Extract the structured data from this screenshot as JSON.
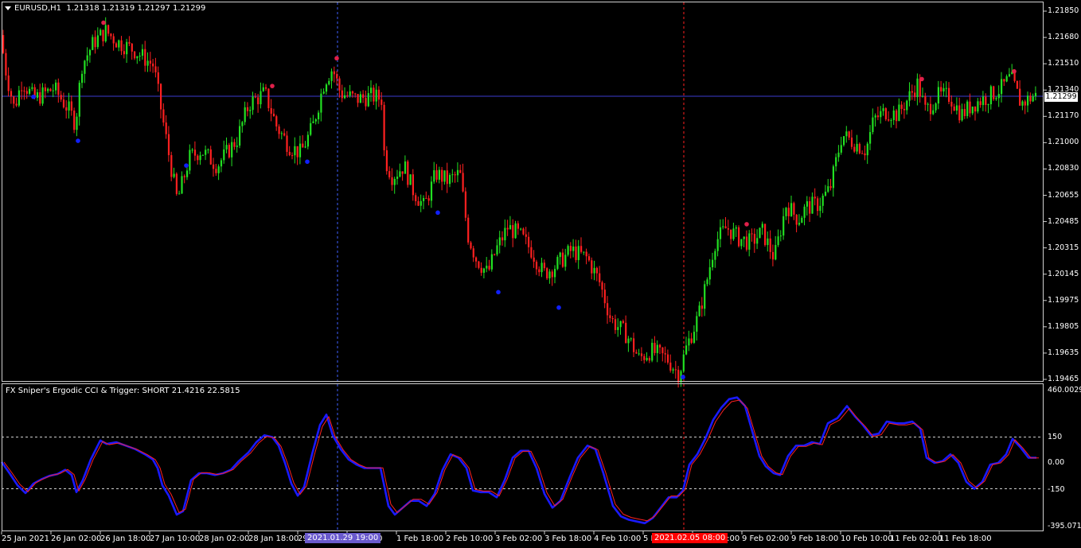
{
  "symbol": "EURUSD,H1",
  "ohlc": {
    "open": "1.21318",
    "high": "1.21319",
    "low": "1.21297",
    "close": "1.21299"
  },
  "indicator": {
    "name": "FX Sniper's Ergodic CCI & Trigger:",
    "signal": "SHORT",
    "value1": "21.4216",
    "value2": "22.5815"
  },
  "price_axis": [
    "1.21850",
    "1.21680",
    "1.21510",
    "1.21340",
    "1.21170",
    "1.21000",
    "1.20830",
    "1.20655",
    "1.20485",
    "1.20315",
    "1.20145",
    "1.19975",
    "1.19805",
    "1.19635",
    "1.19465"
  ],
  "current_price": "1.21299",
  "indicator_axis": {
    "max": "460.0029",
    "upper": "150",
    "zero": "0.00",
    "lower": "-150",
    "min": "-395.0718"
  },
  "time_axis": [
    "25 Jan 2021",
    "26 Jan 02:00",
    "26 Jan 18:00",
    "27 Jan 10:00",
    "28 Jan 02:00",
    "28 Jan 18:00",
    "29 Jan 10:00",
    "eb 02:00",
    "1 Feb 18:00",
    "2 Feb 10:00",
    "3 Feb 02:00",
    "3 Feb 18:00",
    "4 Feb 10:00",
    "5 Feb 18:00",
    "8 Feb 10:00",
    "9 Feb 02:00",
    "9 Feb 18:00",
    "10 Feb 10:00",
    "11 Feb 02:00",
    "11 Feb 18:00"
  ],
  "highlighted_times": {
    "blue": "2021.01.29 19:00",
    "red": "2021.02.05 08:00"
  },
  "colors": {
    "bull": "#22e022",
    "bear": "#ff2020",
    "blue_dot": "#1020ff",
    "red_dot": "#e0204a",
    "cci": "#1a1aff",
    "trigger": "#ff2020",
    "grid_line": "#3c3cd0",
    "vline_blue": "#4060ff",
    "vline_red": "#ff2020",
    "blue_time_bg": "#6a5acd",
    "red_time_bg": "#ff0000"
  },
  "chart_data": {
    "type": "candlestick",
    "price_path": [
      [
        0,
        1.218
      ],
      [
        10,
        1.2145
      ],
      [
        20,
        1.2122
      ],
      [
        30,
        1.214
      ],
      [
        45,
        1.2128
      ],
      [
        70,
        1.2135
      ],
      [
        90,
        1.212
      ],
      [
        97,
        1.2112
      ],
      [
        105,
        1.215
      ],
      [
        120,
        1.2165
      ],
      [
        135,
        1.2172
      ],
      [
        150,
        1.2165
      ],
      [
        170,
        1.216
      ],
      [
        195,
        1.215
      ],
      [
        205,
        1.212
      ],
      [
        215,
        1.209
      ],
      [
        225,
        1.2062
      ],
      [
        240,
        1.209
      ],
      [
        255,
        1.2095
      ],
      [
        275,
        1.2085
      ],
      [
        300,
        1.2102
      ],
      [
        315,
        1.2125
      ],
      [
        335,
        1.2132
      ],
      [
        350,
        1.211
      ],
      [
        365,
        1.2098
      ],
      [
        380,
        1.2093
      ],
      [
        395,
        1.211
      ],
      [
        410,
        1.214
      ],
      [
        420,
        1.2148
      ],
      [
        430,
        1.2132
      ],
      [
        450,
        1.2128
      ],
      [
        470,
        1.213
      ],
      [
        483,
        1.2128
      ],
      [
        485,
        1.209
      ],
      [
        495,
        1.2078
      ],
      [
        510,
        1.2085
      ],
      [
        520,
        1.207
      ],
      [
        535,
        1.2058
      ],
      [
        550,
        1.208
      ],
      [
        565,
        1.2075
      ],
      [
        580,
        1.208
      ],
      [
        590,
        1.204
      ],
      [
        600,
        1.2025
      ],
      [
        615,
        1.2015
      ],
      [
        625,
        1.203
      ],
      [
        640,
        1.2045
      ],
      [
        655,
        1.204
      ],
      [
        670,
        1.203
      ],
      [
        685,
        1.2015
      ],
      [
        700,
        1.202
      ],
      [
        720,
        1.203
      ],
      [
        740,
        1.2025
      ],
      [
        755,
        1.201
      ],
      [
        770,
        1.1985
      ],
      [
        790,
        1.1975
      ],
      [
        805,
        1.196
      ],
      [
        820,
        1.1965
      ],
      [
        840,
        1.196
      ],
      [
        855,
        1.195
      ],
      [
        865,
        1.1968
      ],
      [
        880,
        1.1988
      ],
      [
        890,
        1.201
      ],
      [
        900,
        1.2035
      ],
      [
        915,
        1.2045
      ],
      [
        930,
        1.2038
      ],
      [
        945,
        1.2035
      ],
      [
        960,
        1.2042
      ],
      [
        975,
        1.2025
      ],
      [
        990,
        1.206
      ],
      [
        1005,
        1.205
      ],
      [
        1015,
        1.2058
      ],
      [
        1030,
        1.206
      ],
      [
        1045,
        1.207
      ],
      [
        1060,
        1.2105
      ],
      [
        1075,
        1.21
      ],
      [
        1090,
        1.2095
      ],
      [
        1100,
        1.2115
      ],
      [
        1115,
        1.212
      ],
      [
        1130,
        1.2118
      ],
      [
        1145,
        1.213
      ],
      [
        1155,
        1.2138
      ],
      [
        1165,
        1.212
      ],
      [
        1180,
        1.213
      ],
      [
        1195,
        1.213
      ],
      [
        1210,
        1.2118
      ],
      [
        1225,
        1.2125
      ],
      [
        1245,
        1.213
      ],
      [
        1260,
        1.2135
      ],
      [
        1272,
        1.2142
      ],
      [
        1285,
        1.2125
      ],
      [
        1300,
        1.213
      ]
    ],
    "swing_high_dots": [
      [
        130,
        1.21775
      ],
      [
        342,
        1.21365
      ],
      [
        423,
        1.21545
      ],
      [
        938,
        1.2047
      ],
      [
        1158,
        1.2141
      ],
      [
        1274,
        1.2146
      ]
    ],
    "swing_low_dots": [
      [
        42,
        1.21295
      ],
      [
        98,
        1.2101
      ],
      [
        234,
        1.2085
      ],
      [
        386,
        1.20875
      ],
      [
        550,
        1.20545
      ],
      [
        626,
        1.2003
      ],
      [
        702,
        1.1993
      ],
      [
        858,
        1.1948
      ]
    ],
    "cci_path": [
      [
        2,
        5
      ],
      [
        12,
        -60
      ],
      [
        22,
        -130
      ],
      [
        32,
        -175
      ],
      [
        42,
        -120
      ],
      [
        52,
        -95
      ],
      [
        62,
        -75
      ],
      [
        72,
        -65
      ],
      [
        82,
        -40
      ],
      [
        90,
        -70
      ],
      [
        96,
        -170
      ],
      [
        104,
        -100
      ],
      [
        114,
        20
      ],
      [
        126,
        130
      ],
      [
        134,
        110
      ],
      [
        146,
        120
      ],
      [
        158,
        100
      ],
      [
        170,
        80
      ],
      [
        182,
        50
      ],
      [
        192,
        20
      ],
      [
        198,
        -30
      ],
      [
        204,
        -130
      ],
      [
        212,
        -190
      ],
      [
        222,
        -300
      ],
      [
        230,
        -280
      ],
      [
        240,
        -100
      ],
      [
        250,
        -60
      ],
      [
        260,
        -60
      ],
      [
        270,
        -70
      ],
      [
        280,
        -60
      ],
      [
        290,
        -40
      ],
      [
        300,
        10
      ],
      [
        312,
        60
      ],
      [
        322,
        120
      ],
      [
        332,
        160
      ],
      [
        342,
        150
      ],
      [
        350,
        100
      ],
      [
        358,
        0
      ],
      [
        366,
        -120
      ],
      [
        374,
        -190
      ],
      [
        382,
        -140
      ],
      [
        392,
        50
      ],
      [
        402,
        220
      ],
      [
        410,
        280
      ],
      [
        418,
        160
      ],
      [
        428,
        80
      ],
      [
        438,
        20
      ],
      [
        448,
        -10
      ],
      [
        458,
        -30
      ],
      [
        468,
        -30
      ],
      [
        478,
        -30
      ],
      [
        488,
        -250
      ],
      [
        496,
        -300
      ],
      [
        506,
        -260
      ],
      [
        516,
        -220
      ],
      [
        526,
        -220
      ],
      [
        536,
        -250
      ],
      [
        546,
        -180
      ],
      [
        556,
        -40
      ],
      [
        566,
        50
      ],
      [
        576,
        30
      ],
      [
        586,
        -30
      ],
      [
        594,
        -160
      ],
      [
        604,
        -170
      ],
      [
        614,
        -170
      ],
      [
        624,
        -200
      ],
      [
        634,
        -100
      ],
      [
        644,
        30
      ],
      [
        654,
        70
      ],
      [
        664,
        70
      ],
      [
        674,
        -30
      ],
      [
        684,
        -180
      ],
      [
        694,
        -260
      ],
      [
        704,
        -220
      ],
      [
        716,
        -80
      ],
      [
        726,
        30
      ],
      [
        738,
        100
      ],
      [
        748,
        80
      ],
      [
        758,
        -60
      ],
      [
        770,
        -250
      ],
      [
        780,
        -310
      ],
      [
        790,
        -330
      ],
      [
        800,
        -340
      ],
      [
        810,
        -350
      ],
      [
        820,
        -320
      ],
      [
        830,
        -260
      ],
      [
        840,
        -200
      ],
      [
        850,
        -200
      ],
      [
        858,
        -160
      ],
      [
        866,
        -10
      ],
      [
        876,
        50
      ],
      [
        886,
        140
      ],
      [
        896,
        250
      ],
      [
        906,
        320
      ],
      [
        916,
        370
      ],
      [
        926,
        380
      ],
      [
        936,
        330
      ],
      [
        944,
        200
      ],
      [
        954,
        40
      ],
      [
        962,
        -20
      ],
      [
        972,
        -60
      ],
      [
        980,
        -70
      ],
      [
        990,
        40
      ],
      [
        1000,
        100
      ],
      [
        1010,
        100
      ],
      [
        1020,
        120
      ],
      [
        1030,
        110
      ],
      [
        1040,
        230
      ],
      [
        1052,
        260
      ],
      [
        1064,
        330
      ],
      [
        1074,
        270
      ],
      [
        1084,
        220
      ],
      [
        1094,
        160
      ],
      [
        1104,
        170
      ],
      [
        1114,
        240
      ],
      [
        1126,
        230
      ],
      [
        1136,
        230
      ],
      [
        1146,
        240
      ],
      [
        1156,
        200
      ],
      [
        1164,
        30
      ],
      [
        1174,
        0
      ],
      [
        1184,
        10
      ],
      [
        1194,
        50
      ],
      [
        1204,
        0
      ],
      [
        1214,
        -110
      ],
      [
        1224,
        -150
      ],
      [
        1234,
        -110
      ],
      [
        1244,
        -10
      ],
      [
        1254,
        0
      ],
      [
        1264,
        50
      ],
      [
        1272,
        140
      ],
      [
        1282,
        90
      ],
      [
        1292,
        30
      ],
      [
        1302,
        30
      ]
    ]
  }
}
